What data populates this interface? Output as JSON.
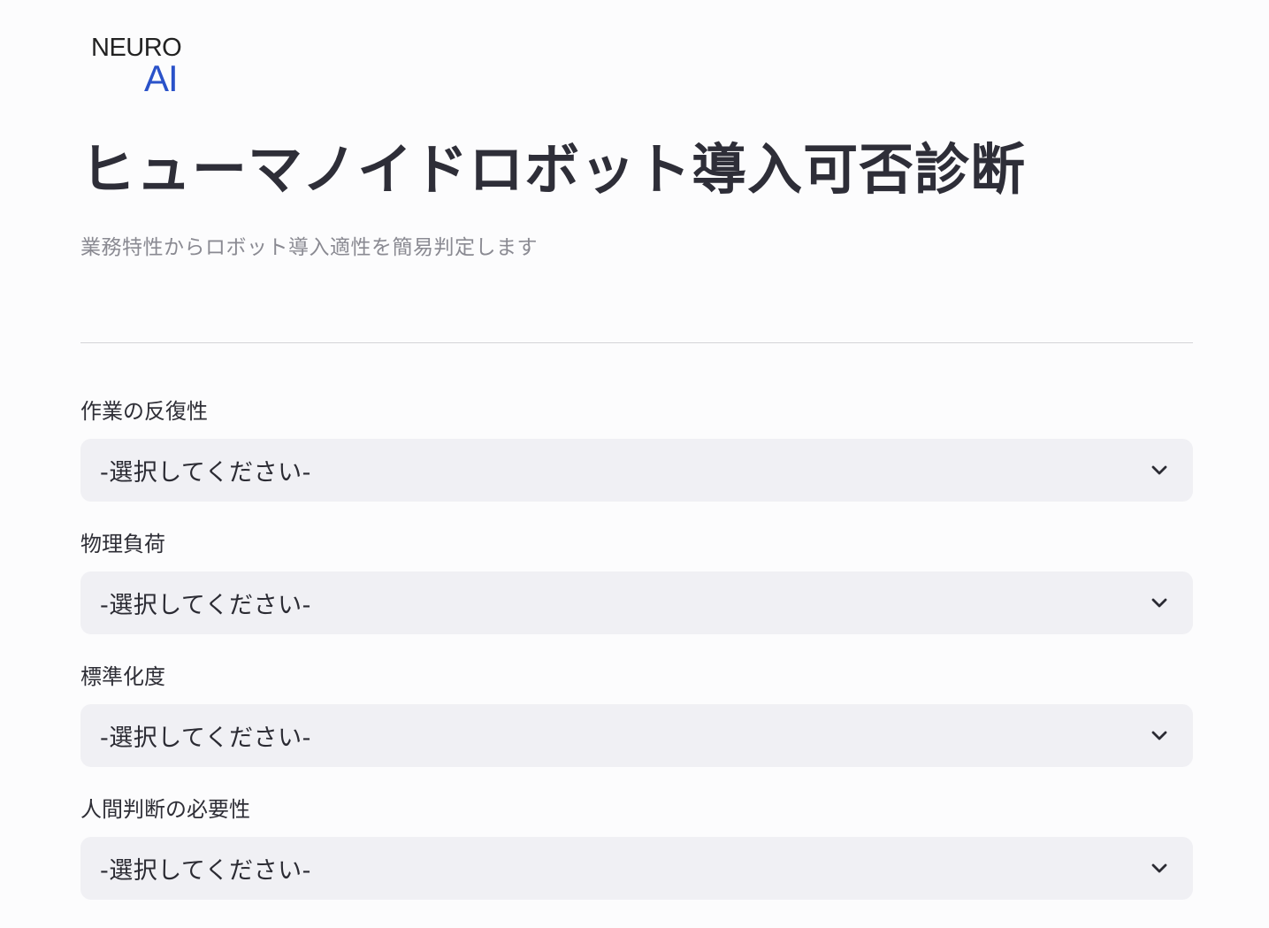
{
  "logo": {
    "line1": "NEURO",
    "line2": "AI"
  },
  "page": {
    "title": "ヒューマノイドロボット導入可否診断",
    "subtitle": "業務特性からロボット導入適性を簡易判定します"
  },
  "fields": [
    {
      "label": "作業の反復性",
      "value": "-選択してください-"
    },
    {
      "label": "物理負荷",
      "value": "-選択してください-"
    },
    {
      "label": "標準化度",
      "value": "-選択してください-"
    },
    {
      "label": "人間判断の必要性",
      "value": "-選択してください-"
    }
  ],
  "icons": {
    "dropdown": "chevron-down-icon"
  },
  "colors": {
    "brand_accent": "#2a52c9",
    "select_bg": "#f0f0f4"
  }
}
